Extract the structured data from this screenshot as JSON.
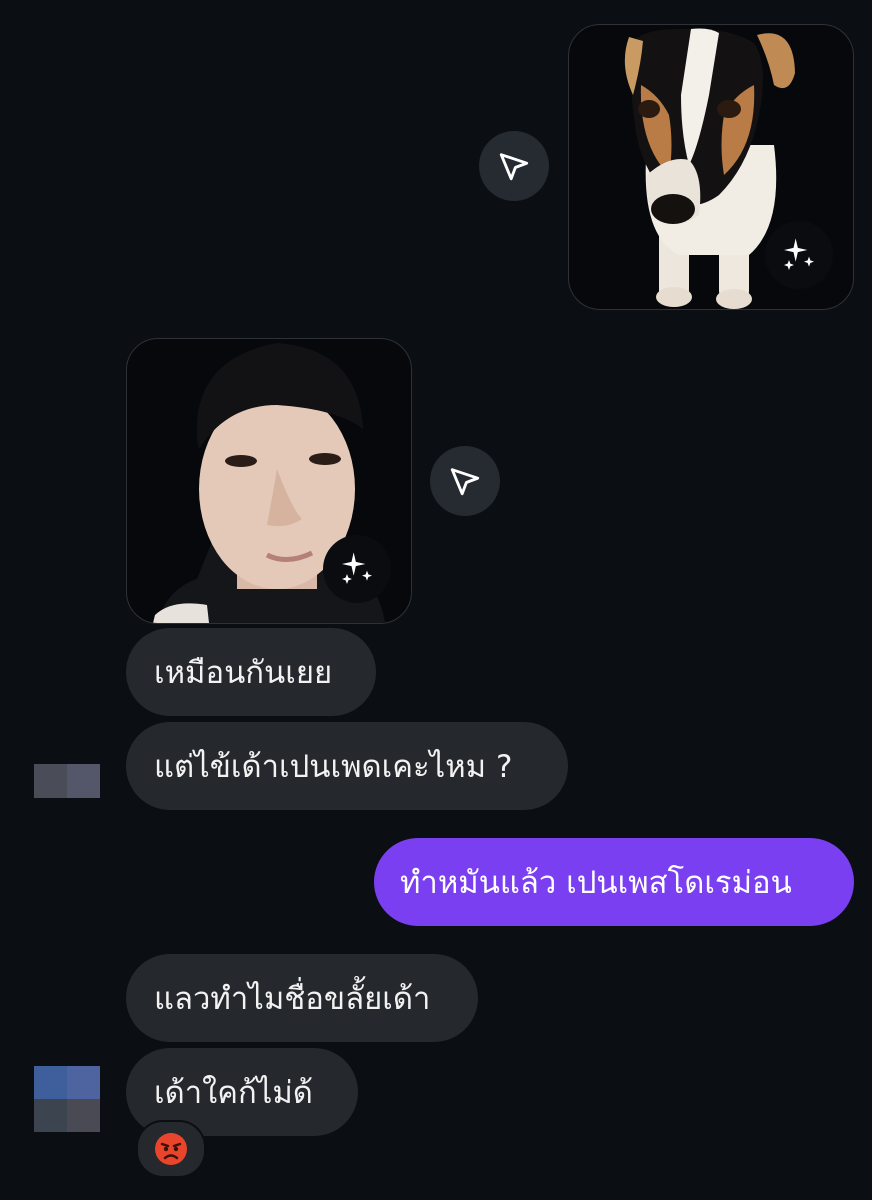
{
  "messages": {
    "m1": "เหมือนกันเยย",
    "m2": "แต่ไข้เด้าเปนเพดเคะไหม ?",
    "m3": "ทำหมันแล้ว เปนเพสโดเรม่อน",
    "m4": "แลวทำไมชื่อขลั้ยเด้า",
    "m5": "เด้าใคก้ไม่ด้"
  },
  "reaction": {
    "emoji": "angry-face"
  },
  "colors": {
    "background": "#0b0f14",
    "incoming_bubble": "#25282d",
    "outgoing_bubble": "#7b3ff2",
    "share_button": "#262a31"
  },
  "icons": {
    "share": "send-paper-plane-icon",
    "ai": "sparkles-icon"
  }
}
